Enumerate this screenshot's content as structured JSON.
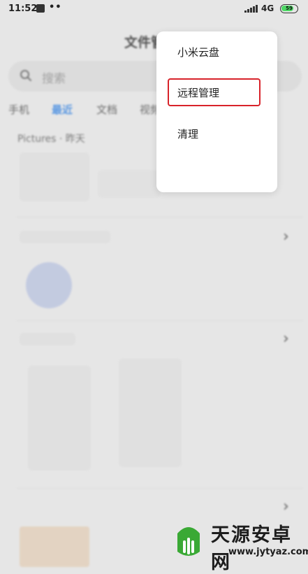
{
  "status_bar": {
    "time": "11:52",
    "dots": "••",
    "network": "4G",
    "battery_percent": "59",
    "battery_color": "#4cd964"
  },
  "header": {
    "title": "文件管理"
  },
  "search": {
    "placeholder": "搜索"
  },
  "tabs": [
    {
      "label": "手机",
      "active": false
    },
    {
      "label": "最近",
      "active": true
    },
    {
      "label": "文档",
      "active": false
    },
    {
      "label": "视频",
      "active": false
    }
  ],
  "section": {
    "title": "Pictures · 昨天"
  },
  "menu": {
    "items": [
      {
        "label": "小米云盘"
      },
      {
        "label": "远程管理",
        "highlighted": true
      },
      {
        "label": "清理"
      }
    ],
    "highlight_color": "#d8232a"
  },
  "accent_color": "#2a7de1",
  "watermark": {
    "title": "天源安卓网",
    "url": "www.jytyaz.com"
  }
}
